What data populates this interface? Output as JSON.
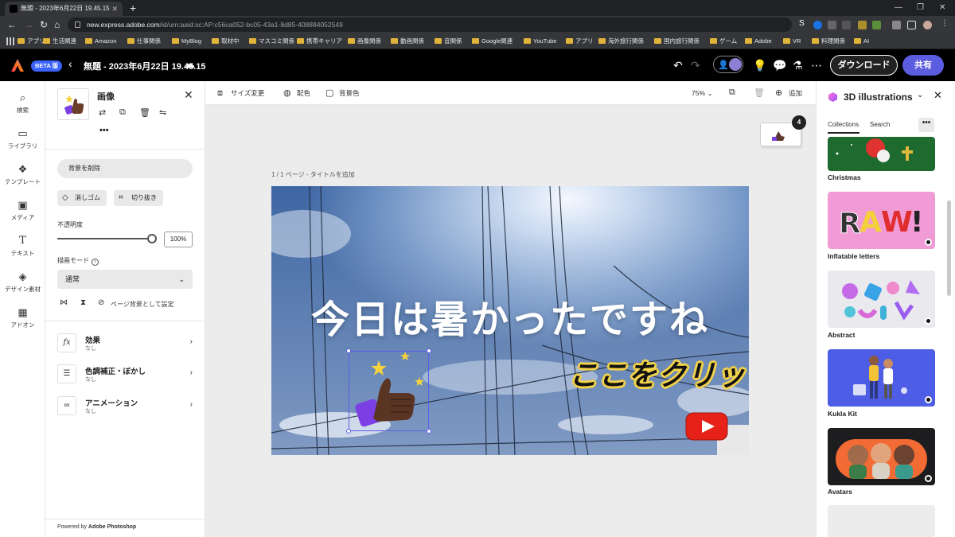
{
  "browser": {
    "tab_title": "無題 - 2023年6月22日 19.45.15",
    "new_tab": "+",
    "url_host": "new.express.adobe.com",
    "url_path": "/id/urn:aaid:sc:AP:c56ca052-bc05-43a1-8d85-408884052549",
    "bookmarks": [
      "アプリ",
      "生活関連",
      "Amazon",
      "仕事関係",
      "MyBlog",
      "取材中",
      "マスコミ関係",
      "携帯キャリア",
      "画像関係",
      "動画関係",
      "音関係",
      "Google関連",
      "YouTube",
      "アプリ",
      "海外旅行関係",
      "国内旅行関係",
      "ゲーム",
      "Adobe",
      "VR",
      "料理関係",
      "AI"
    ]
  },
  "header": {
    "beta_label": "BETA 版",
    "doc_title": "無題 - 2023年6月22日 19.45.15",
    "download_label": "ダウンロード",
    "share_label": "共有"
  },
  "left_rail": {
    "items": [
      {
        "label": "検索",
        "icon": "search-icon"
      },
      {
        "label": "ライブラリ",
        "icon": "folder-icon"
      },
      {
        "label": "テンプレート",
        "icon": "template-icon"
      },
      {
        "label": "メディア",
        "icon": "media-icon"
      },
      {
        "label": "テキスト",
        "icon": "text-icon"
      },
      {
        "label": "デザイン素材",
        "icon": "shapes-icon"
      },
      {
        "label": "アドオン",
        "icon": "addon-icon"
      }
    ]
  },
  "properties": {
    "title": "画像",
    "more": "•••",
    "remove_bg": "背景を削除",
    "eraser": "消しゴム",
    "crop": "切り抜き",
    "opacity_label": "不透明度",
    "opacity_value": "100%",
    "opacity_fraction": 1.0,
    "blend_label": "描画モード",
    "blend_value": "通常",
    "set_page_bg": "ページ背景として設定",
    "effects": {
      "title": "効果",
      "sub": "なし"
    },
    "adjust": {
      "title": "色調補正・ぼかし",
      "sub": "なし"
    },
    "animation": {
      "title": "アニメーション",
      "sub": "なし"
    },
    "powered_prefix": "Powered by ",
    "powered_brand": "Adobe Photoshop"
  },
  "toolbar": {
    "resize": "サイズ変更",
    "color": "配色",
    "bgcolor": "背景色",
    "zoom": "75%",
    "add": "追加"
  },
  "canvas": {
    "page_count_badge": "4",
    "page_label": "1 / 1 ページ - タイトルを追加",
    "headline": "今日は暑かったですね",
    "annotation": "ここをクリック→"
  },
  "right_panel": {
    "title": "3D illustrations",
    "tab_collections": "Collections",
    "tab_search": "Search",
    "more": "•••",
    "cards": [
      {
        "label": "Christmas"
      },
      {
        "label": "Inflatable letters"
      },
      {
        "label": "Abstract"
      },
      {
        "label": "Kukla Kit"
      },
      {
        "label": "Avatars"
      }
    ]
  },
  "colors": {
    "accent": "#5c5ce0",
    "beta": "#3b63fb",
    "selection": "#5b5fe6",
    "annotation_outline": "#f2d24a"
  }
}
